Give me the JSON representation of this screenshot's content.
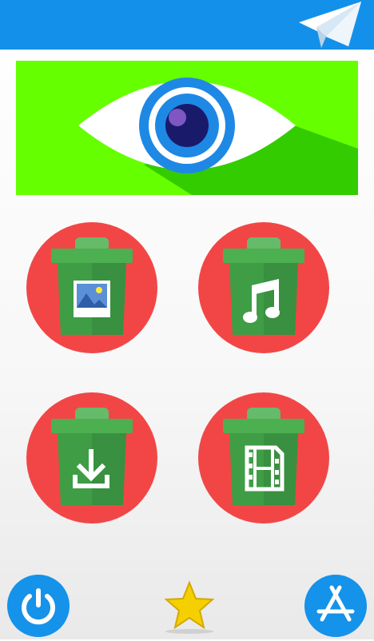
{
  "header": {
    "send_icon": "paper-plane-icon",
    "color": "#1391ea"
  },
  "banner": {
    "icon": "eye-icon",
    "background": "#66ff00"
  },
  "tiles": [
    {
      "icon": "trash-image-icon",
      "content": "image"
    },
    {
      "icon": "trash-music-icon",
      "content": "music"
    },
    {
      "icon": "trash-download-icon",
      "content": "download"
    },
    {
      "icon": "trash-video-icon",
      "content": "video"
    }
  ],
  "footer": {
    "left_icon": "power-icon",
    "center_icon": "star-icon",
    "right_icon": "app-store-icon"
  },
  "colors": {
    "accent": "#1592ea",
    "tile_circle": "#f24646",
    "bin_body": "#3f9d45",
    "bin_lid": "#4caf50",
    "star": "#f5d000"
  }
}
